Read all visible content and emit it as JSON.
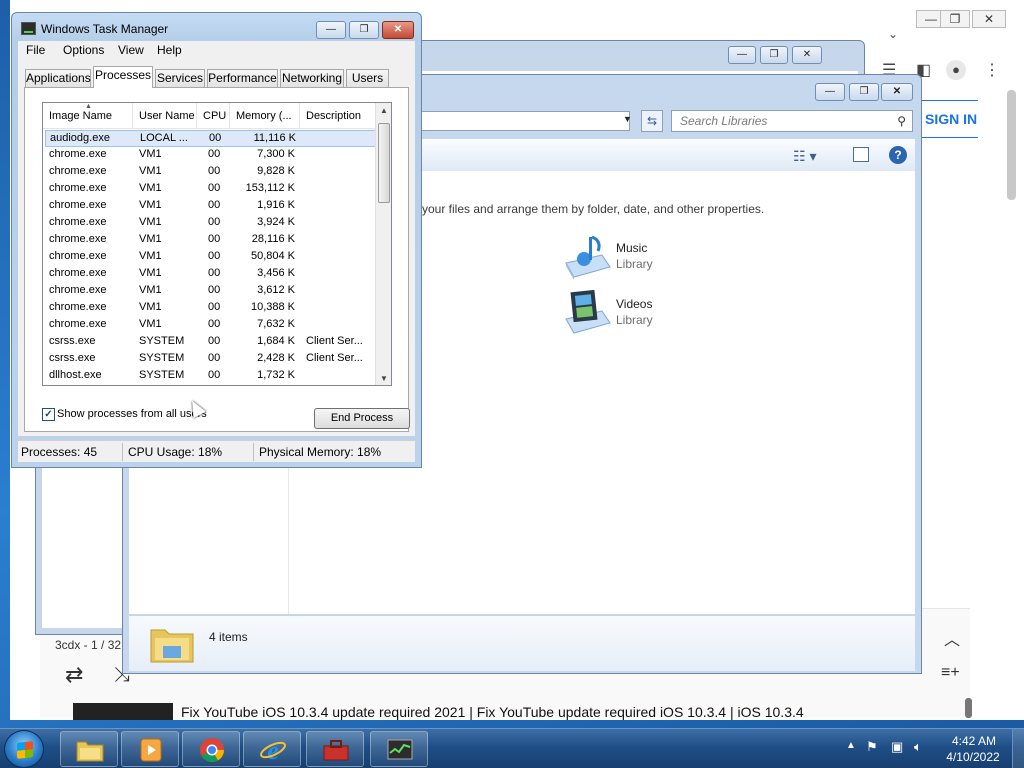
{
  "chrome": {
    "sign_in_label": "SIGN IN",
    "playlist_info": "3cdx - 1 / 32",
    "video_title": "Fix YouTube iOS 10.3.4 update required 2021 | Fix YouTube update required iOS 10.3.4 | iOS 10.3.4"
  },
  "explorer": {
    "search_placeholder": "Search Libraries",
    "description": "your files and arrange them by folder, date, and other properties.",
    "libraries": [
      {
        "name": "Music",
        "type": "Library"
      },
      {
        "name": "Videos",
        "type": "Library"
      }
    ],
    "item_count": "4 items"
  },
  "taskmgr": {
    "title": "Windows Task Manager",
    "menu": [
      "File",
      "Options",
      "View",
      "Help"
    ],
    "tabs": [
      "Applications",
      "Processes",
      "Services",
      "Performance",
      "Networking",
      "Users"
    ],
    "columns": [
      "Image Name",
      "User Name",
      "CPU",
      "Memory (...",
      "Description"
    ],
    "rows": [
      {
        "name": "audiodg.exe",
        "user": "LOCAL ...",
        "cpu": "00",
        "mem": "11,116 K",
        "desc": ""
      },
      {
        "name": "chrome.exe",
        "user": "VM1",
        "cpu": "00",
        "mem": "7,300 K",
        "desc": ""
      },
      {
        "name": "chrome.exe",
        "user": "VM1",
        "cpu": "00",
        "mem": "9,828 K",
        "desc": ""
      },
      {
        "name": "chrome.exe",
        "user": "VM1",
        "cpu": "00",
        "mem": "153,112 K",
        "desc": ""
      },
      {
        "name": "chrome.exe",
        "user": "VM1",
        "cpu": "00",
        "mem": "1,916 K",
        "desc": ""
      },
      {
        "name": "chrome.exe",
        "user": "VM1",
        "cpu": "00",
        "mem": "3,924 K",
        "desc": ""
      },
      {
        "name": "chrome.exe",
        "user": "VM1",
        "cpu": "00",
        "mem": "28,116 K",
        "desc": ""
      },
      {
        "name": "chrome.exe",
        "user": "VM1",
        "cpu": "00",
        "mem": "50,804 K",
        "desc": ""
      },
      {
        "name": "chrome.exe",
        "user": "VM1",
        "cpu": "00",
        "mem": "3,456 K",
        "desc": ""
      },
      {
        "name": "chrome.exe",
        "user": "VM1",
        "cpu": "00",
        "mem": "3,612 K",
        "desc": ""
      },
      {
        "name": "chrome.exe",
        "user": "VM1",
        "cpu": "00",
        "mem": "10,388 K",
        "desc": ""
      },
      {
        "name": "chrome.exe",
        "user": "VM1",
        "cpu": "00",
        "mem": "7,632 K",
        "desc": ""
      },
      {
        "name": "csrss.exe",
        "user": "SYSTEM",
        "cpu": "00",
        "mem": "1,684 K",
        "desc": "Client Ser..."
      },
      {
        "name": "csrss.exe",
        "user": "SYSTEM",
        "cpu": "00",
        "mem": "2,428 K",
        "desc": "Client Ser..."
      },
      {
        "name": "dllhost.exe",
        "user": "SYSTEM",
        "cpu": "00",
        "mem": "1,732 K",
        "desc": ""
      }
    ],
    "show_all_label": "Show processes from all users",
    "show_all_checked": true,
    "end_process_label": "End Process",
    "status": {
      "processes": "Processes: 45",
      "cpu": "CPU Usage: 18%",
      "memory": "Physical Memory: 18%"
    }
  },
  "taskbar": {
    "clock_time": "4:42 AM",
    "clock_date": "4/10/2022"
  }
}
